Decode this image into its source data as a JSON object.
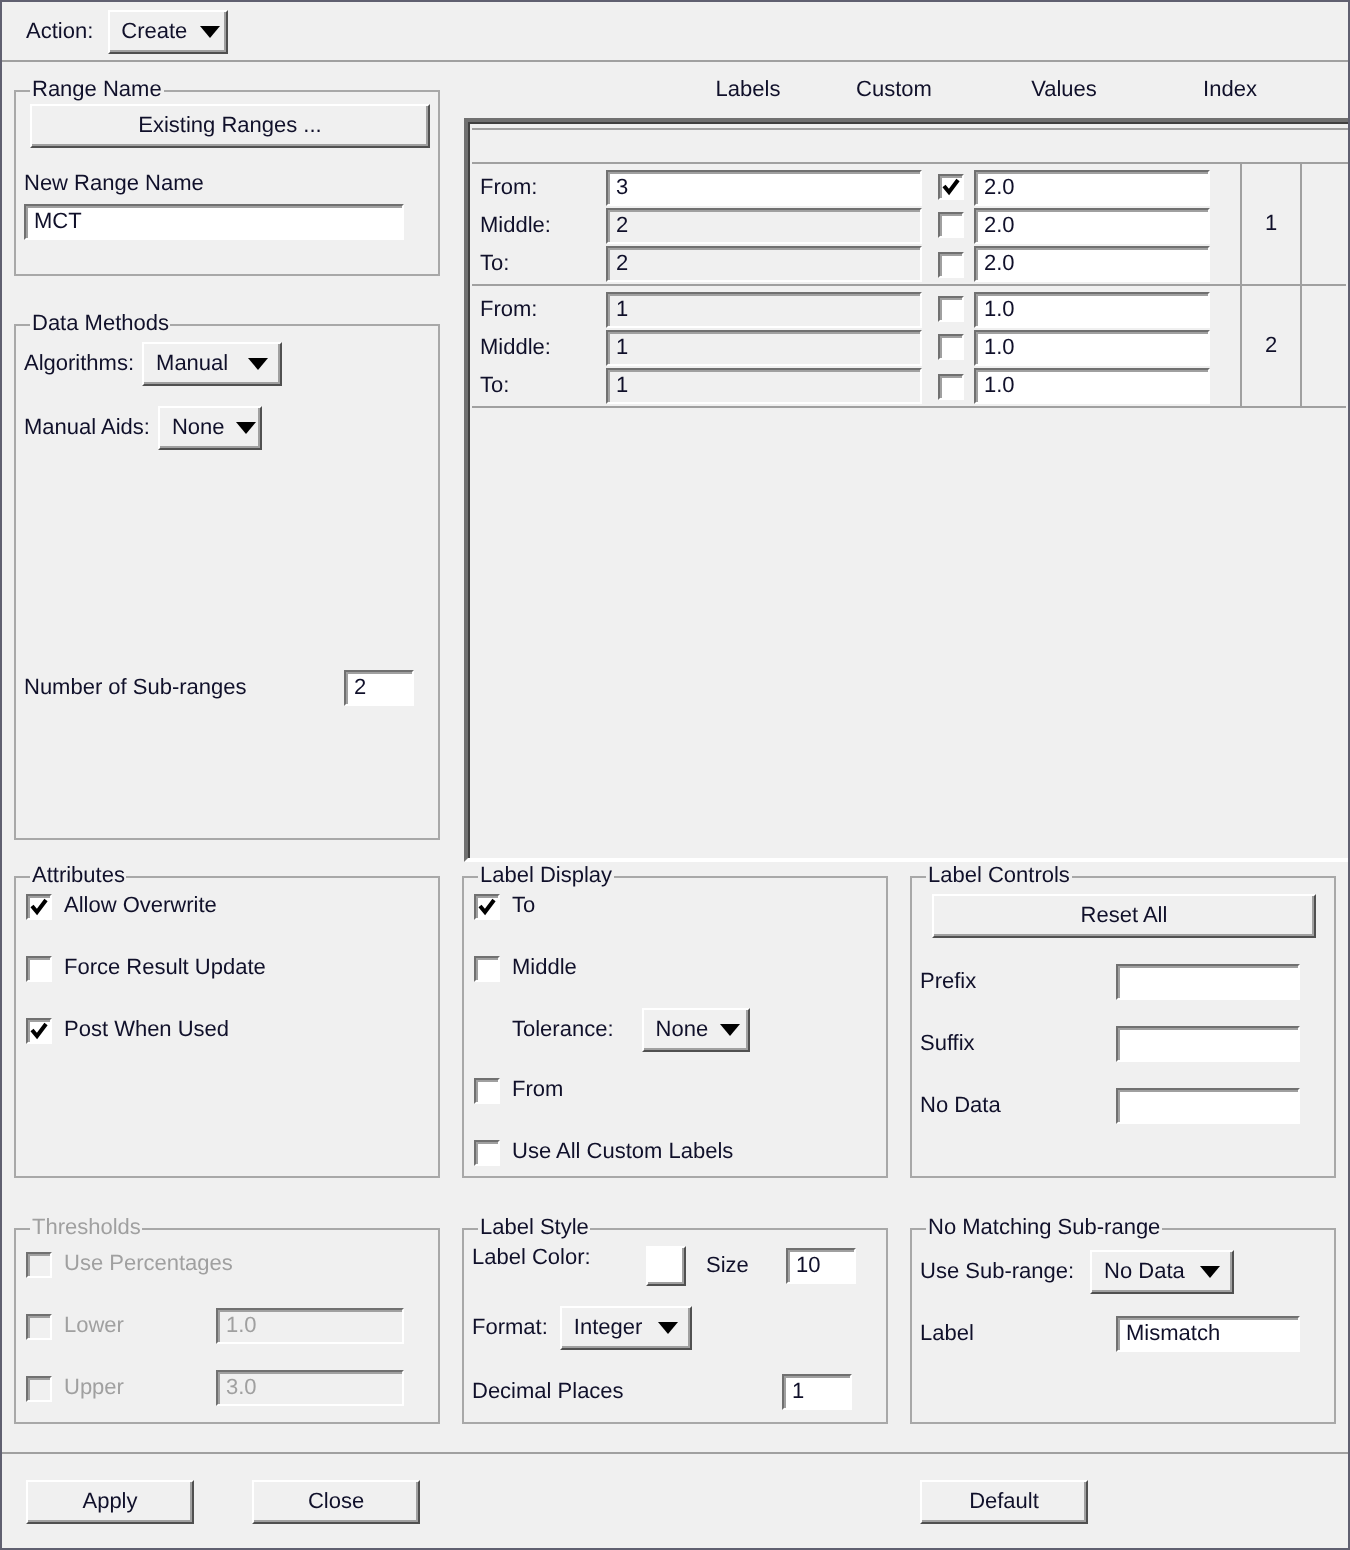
{
  "action": {
    "label": "Action:",
    "value": "Create"
  },
  "range_name": {
    "title": "Range Name",
    "button": "Existing Ranges ...",
    "field_label": "New Range Name",
    "value": "MCT"
  },
  "data_methods": {
    "title": "Data Methods",
    "algorithms": {
      "label": "Algorithms:",
      "value": "Manual"
    },
    "manual_aids": {
      "label": "Manual Aids:",
      "value": "None"
    },
    "sub_ranges": {
      "label": "Number of Sub-ranges",
      "value": "2"
    }
  },
  "table": {
    "columns": [
      "Labels",
      "Custom",
      "Values",
      "Index"
    ],
    "groups": [
      {
        "index": "1",
        "rows": [
          {
            "label": "From:",
            "text": "3",
            "disabled": false,
            "custom": true,
            "value": "2.0"
          },
          {
            "label": "Middle:",
            "text": "2",
            "disabled": true,
            "custom": false,
            "value": "2.0"
          },
          {
            "label": "To:",
            "text": "2",
            "disabled": true,
            "custom": false,
            "value": "2.0"
          }
        ]
      },
      {
        "index": "2",
        "rows": [
          {
            "label": "From:",
            "text": "1",
            "disabled": true,
            "custom": false,
            "value": "1.0"
          },
          {
            "label": "Middle:",
            "text": "1",
            "disabled": true,
            "custom": false,
            "value": "1.0"
          },
          {
            "label": "To:",
            "text": "1",
            "disabled": true,
            "custom": false,
            "value": "1.0"
          }
        ]
      }
    ]
  },
  "attributes": {
    "title": "Attributes",
    "items": [
      {
        "label": "Allow Overwrite",
        "checked": true
      },
      {
        "label": "Force Result Update",
        "checked": false
      },
      {
        "label": "Post When Used",
        "checked": true
      }
    ]
  },
  "label_display": {
    "title": "Label Display",
    "items": [
      {
        "kind": "checkbox",
        "label": "To",
        "checked": true
      },
      {
        "kind": "checkbox",
        "label": "Middle",
        "checked": false
      },
      {
        "kind": "dropdown",
        "label": "Tolerance:",
        "value": "None"
      },
      {
        "kind": "checkbox",
        "label": "From",
        "checked": false
      },
      {
        "kind": "checkbox",
        "label": "Use All Custom Labels",
        "checked": false
      }
    ]
  },
  "label_controls": {
    "title": "Label Controls",
    "button": "Reset All",
    "fields": [
      {
        "label": "Prefix"
      },
      {
        "label": "Suffix"
      },
      {
        "label": "No Data"
      }
    ]
  },
  "thresholds": {
    "title": "Thresholds",
    "disabled": true,
    "items": [
      {
        "kind": "checkbox",
        "label": "Use Percentages",
        "checked": false
      },
      {
        "kind": "checkbox-field",
        "label": "Lower",
        "checked": false,
        "value": "1.0"
      },
      {
        "kind": "checkbox-field",
        "label": "Upper",
        "checked": false,
        "value": "3.0"
      }
    ]
  },
  "label_style": {
    "title": "Label Style",
    "color_label": "Label Color:",
    "color": "#ffffff",
    "size_label": "Size",
    "size": "10",
    "format": {
      "label": "Format:",
      "value": "Integer"
    },
    "decimals": {
      "label": "Decimal Places",
      "value": "1"
    }
  },
  "no_matching": {
    "title": "No Matching Sub-range",
    "use": {
      "label": "Use Sub-range:",
      "value": "No Data"
    },
    "label": {
      "label": "Label",
      "value": "Mismatch"
    }
  },
  "buttons": [
    "Apply",
    "Close",
    "Default"
  ]
}
